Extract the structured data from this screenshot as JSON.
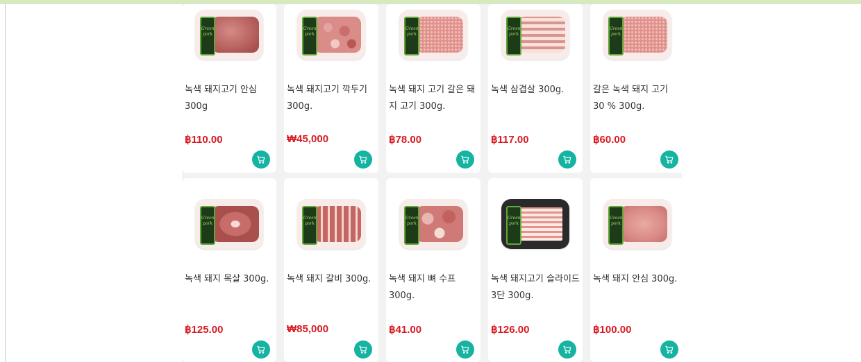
{
  "colors": {
    "accent": "#14b3a2",
    "price": "#d81b23",
    "topbar": "#d7e9c1"
  },
  "products": [
    {
      "name": "녹색 돼지고기 안심 300g",
      "price": "฿110.00",
      "image": "pork-loin-image",
      "brand": "Green pork"
    },
    {
      "name": "녹색 돼지고기 깍두기 300g.",
      "price": "₩45,000",
      "image": "pork-cubes-image",
      "brand": "Green pork"
    },
    {
      "name": "녹색 돼지 고기 갈은 돼지 고기 300g.",
      "price": "฿78.00",
      "image": "ground-pork-image",
      "brand": "Green pork"
    },
    {
      "name": "녹색 삼겹살 300g.",
      "price": "฿117.00",
      "image": "pork-belly-image",
      "brand": "Green pork"
    },
    {
      "name": "갈은 녹색 돼지 고기 30 % 300g.",
      "price": "฿60.00",
      "image": "ground-pork-image",
      "brand": "Green pork"
    },
    {
      "name": "녹색 돼지 목살 300g.",
      "price": "฿125.00",
      "image": "pork-neck-image",
      "brand": "Green pork"
    },
    {
      "name": "녹색 돼지 갈비 300g.",
      "price": "₩85,000",
      "image": "pork-ribs-image",
      "brand": "Green pork"
    },
    {
      "name": "녹색 돼지 뼈 수프 300g.",
      "price": "฿41.00",
      "image": "pork-soup-bones-image",
      "brand": "Green pork"
    },
    {
      "name": "녹색 돼지고기 슬라이드 3단 300g.",
      "price": "฿126.00",
      "image": "sliced-pork-image",
      "brand": "Green pork"
    },
    {
      "name": "녹색 돼지 안심 300g.",
      "price": "฿100.00",
      "image": "pork-cutlet-image",
      "brand": "Green pork"
    }
  ],
  "cart_icon": "cart-icon"
}
